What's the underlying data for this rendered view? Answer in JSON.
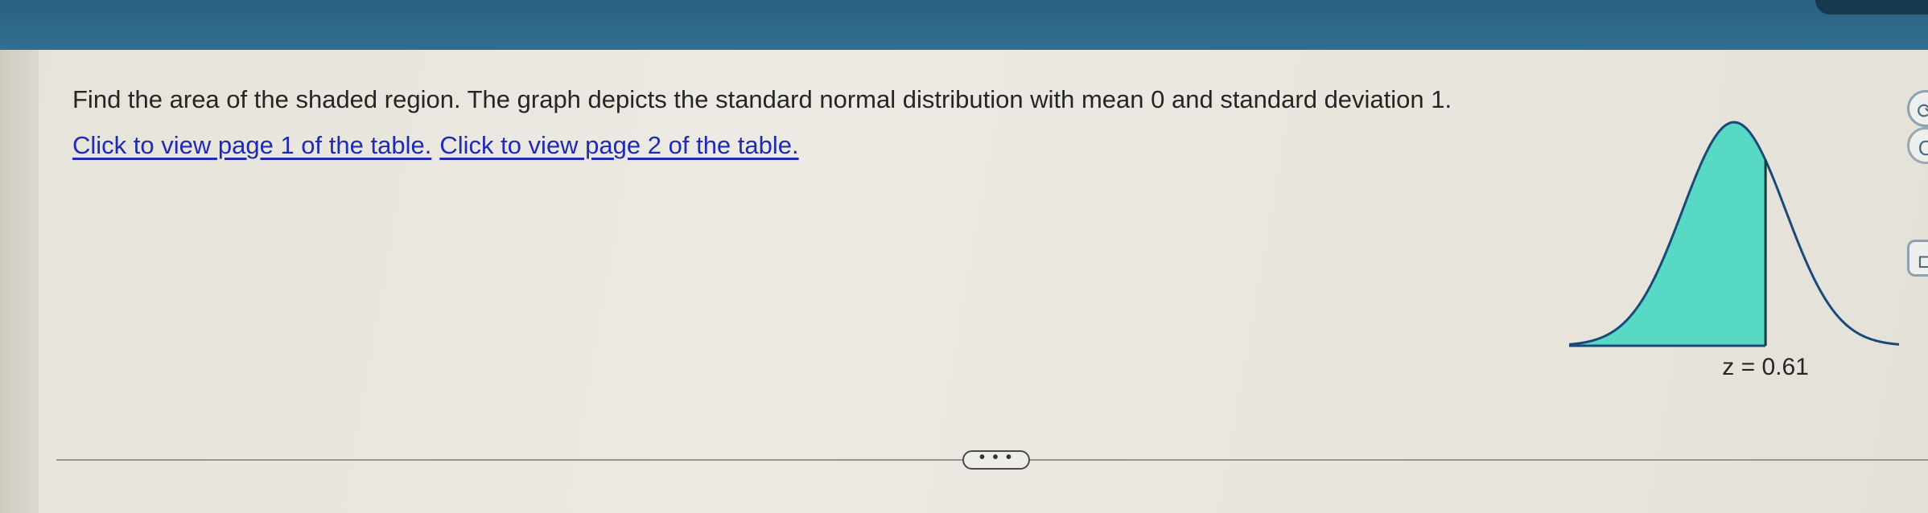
{
  "question": {
    "text": "Find the area of the shaded region. The graph depicts the standard normal distribution with mean 0 and standard deviation 1."
  },
  "links": {
    "page1": "Click to view page 1 of the table.",
    "page2": "Click to view page 2 of the table."
  },
  "graph": {
    "z_label": "z = 0.61",
    "z_value": 0.61,
    "shaded": "left",
    "fill_color": "#57d9c6",
    "curve_color": "#1a4a78",
    "line_color": "#0a3a3a"
  },
  "more_button": {
    "label": "• • •"
  },
  "side_buttons": [
    {
      "icon": "refresh-icon",
      "glyph": "⟳"
    },
    {
      "icon": "back-icon",
      "glyph": "C"
    },
    {
      "icon": "expand-icon",
      "glyph": "⊏"
    }
  ]
}
